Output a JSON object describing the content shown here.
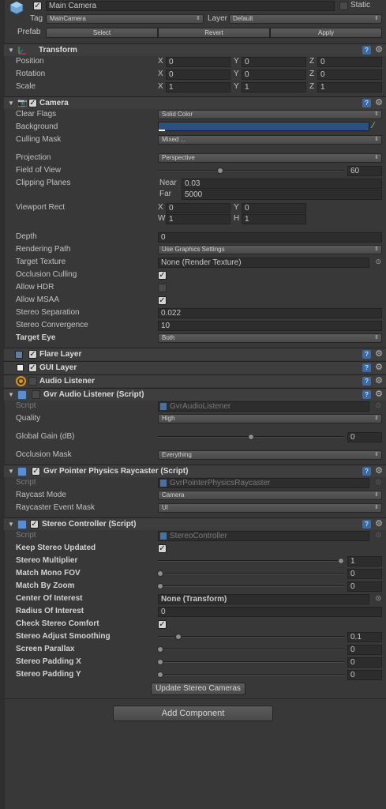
{
  "header": {
    "name": "Main Camera",
    "static_label": "Static",
    "tag_label": "Tag",
    "tag_value": "MainCamera",
    "layer_label": "Layer",
    "layer_value": "Default",
    "prefab_label": "Prefab",
    "select_label": "Select",
    "revert_label": "Revert",
    "apply_label": "Apply"
  },
  "transform": {
    "title": "Transform",
    "rows": [
      {
        "label": "Position",
        "x": "0",
        "y": "0",
        "z": "0"
      },
      {
        "label": "Rotation",
        "x": "0",
        "y": "0",
        "z": "0"
      },
      {
        "label": "Scale",
        "x": "1",
        "y": "1",
        "z": "1"
      }
    ],
    "axis_x": "X",
    "axis_y": "Y",
    "axis_z": "Z"
  },
  "camera": {
    "title": "Camera",
    "clear_flags_label": "Clear Flags",
    "clear_flags_value": "Solid Color",
    "background_label": "Background",
    "background_color": "#2e4f82",
    "culling_mask_label": "Culling Mask",
    "culling_mask_value": "Mixed ...",
    "projection_label": "Projection",
    "projection_value": "Perspective",
    "fov_label": "Field of View",
    "fov_value": "60",
    "clipping_label": "Clipping Planes",
    "near_label": "Near",
    "near_value": "0.03",
    "far_label": "Far",
    "far_value": "5000",
    "viewport_label": "Viewport Rect",
    "vp_x_label": "X",
    "vp_x": "0",
    "vp_y_label": "Y",
    "vp_y": "0",
    "vp_w_label": "W",
    "vp_w": "1",
    "vp_h_label": "H",
    "vp_h": "1",
    "depth_label": "Depth",
    "depth_value": "0",
    "rendering_path_label": "Rendering Path",
    "rendering_path_value": "Use Graphics Settings",
    "target_texture_label": "Target Texture",
    "target_texture_value": "None (Render Texture)",
    "occlusion_label": "Occlusion Culling",
    "hdr_label": "Allow HDR",
    "msaa_label": "Allow MSAA",
    "stereo_sep_label": "Stereo Separation",
    "stereo_sep_value": "0.022",
    "stereo_conv_label": "Stereo Convergence",
    "stereo_conv_value": "10",
    "target_eye_label": "Target Eye",
    "target_eye_value": "Both"
  },
  "flare_layer": {
    "title": "Flare Layer"
  },
  "gui_layer": {
    "title": "GUI Layer"
  },
  "audio_listener": {
    "title": "Audio Listener"
  },
  "gvr_audio": {
    "title": "Gvr Audio Listener (Script)",
    "script_label": "Script",
    "script_value": "GvrAudioListener",
    "quality_label": "Quality",
    "quality_value": "High",
    "gain_label": "Global Gain (dB)",
    "gain_value": "0",
    "occlusion_mask_label": "Occlusion Mask",
    "occlusion_mask_value": "Everything"
  },
  "gvr_pointer": {
    "title": "Gvr Pointer Physics Raycaster (Script)",
    "script_label": "Script",
    "script_value": "GvrPointerPhysicsRaycaster",
    "raycast_mode_label": "Raycast Mode",
    "raycast_mode_value": "Camera",
    "event_mask_label": "Raycaster Event Mask",
    "event_mask_value": "UI"
  },
  "stereo_controller": {
    "title": "Stereo Controller (Script)",
    "script_label": "Script",
    "script_value": "StereoController",
    "keep_updated_label": "Keep Stereo Updated",
    "multiplier_label": "Stereo Multiplier",
    "multiplier_value": "1",
    "match_fov_label": "Match Mono FOV",
    "match_fov_value": "0",
    "match_zoom_label": "Match By Zoom",
    "match_zoom_value": "0",
    "center_label": "Center Of Interest",
    "center_value": "None (Transform)",
    "radius_label": "Radius Of Interest",
    "radius_value": "0",
    "check_comfort_label": "Check Stereo Comfort",
    "smoothing_label": "Stereo Adjust Smoothing",
    "smoothing_value": "0.1",
    "parallax_label": "Screen Parallax",
    "parallax_value": "0",
    "padding_x_label": "Stereo Padding X",
    "padding_x_value": "0",
    "padding_y_label": "Stereo Padding Y",
    "padding_y_value": "0",
    "update_button": "Update Stereo Cameras"
  },
  "add_component": "Add Component"
}
